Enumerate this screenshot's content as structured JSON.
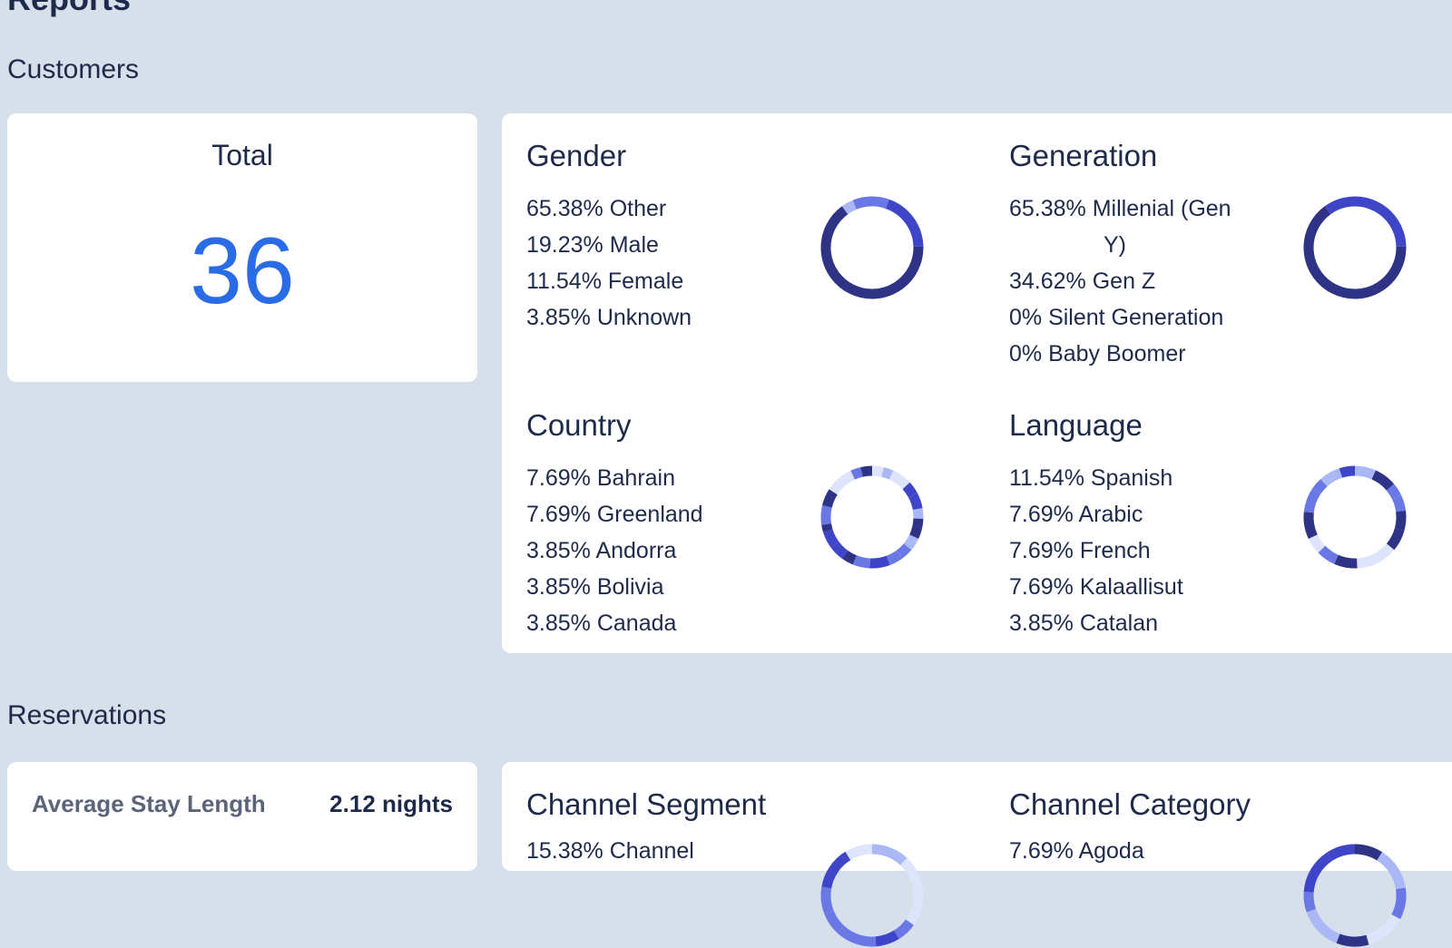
{
  "page": {
    "title": "Reports"
  },
  "customers": {
    "section_title": "Customers",
    "total": {
      "label": "Total",
      "value": "36"
    },
    "gender": {
      "title": "Gender",
      "items": [
        {
          "text": "65.38% Other",
          "pct": 65.38,
          "color": "#2e3385"
        },
        {
          "text": "19.23% Male",
          "pct": 19.23,
          "color": "#3f45c8"
        },
        {
          "text": "11.54% Female",
          "pct": 11.54,
          "color": "#6a78e6"
        },
        {
          "text": "3.85% Unknown",
          "pct": 3.85,
          "color": "#aab8f5"
        }
      ]
    },
    "generation": {
      "title": "Generation",
      "items": [
        {
          "text": "65.38% Millenial (Gen",
          "cont": "Y)",
          "pct": 65.38,
          "color": "#2e3385"
        },
        {
          "text": "34.62% Gen Z",
          "pct": 34.62,
          "color": "#3f45c8"
        },
        {
          "text": "0% Silent Generation",
          "pct": 0,
          "color": "#6a78e6"
        },
        {
          "text": "0% Baby Boomer",
          "pct": 0,
          "color": "#aab8f5"
        }
      ]
    },
    "country": {
      "title": "Country",
      "items": [
        {
          "text": "7.69% Bahrain"
        },
        {
          "text": "7.69% Greenland"
        },
        {
          "text": "3.85% Andorra"
        },
        {
          "text": "3.85% Bolivia"
        },
        {
          "text": "3.85% Canada"
        }
      ]
    },
    "language": {
      "title": "Language",
      "items": [
        {
          "text": "11.54% Spanish"
        },
        {
          "text": "7.69% Arabic"
        },
        {
          "text": "7.69% French"
        },
        {
          "text": "7.69% Kalaallisut"
        },
        {
          "text": "3.85% Catalan"
        }
      ]
    }
  },
  "reservations": {
    "section_title": "Reservations",
    "average_stay": {
      "label": "Average Stay Length",
      "value": "2.12 nights"
    },
    "channel_segment": {
      "title": "Channel Segment",
      "first_line": "15.38% Channel"
    },
    "channel_category": {
      "title": "Channel Category",
      "first_line": "7.69% Agoda"
    }
  },
  "colors": {
    "background": "#d7e0ea",
    "card": "#ffffff",
    "accent_blue": "#2a6be6",
    "text_primary": "#1e2a4a",
    "text_muted": "#5b6478",
    "donut_palette": [
      "#2e3385",
      "#3f45c8",
      "#6a78e6",
      "#aab8f5",
      "#dde4fb"
    ]
  }
}
